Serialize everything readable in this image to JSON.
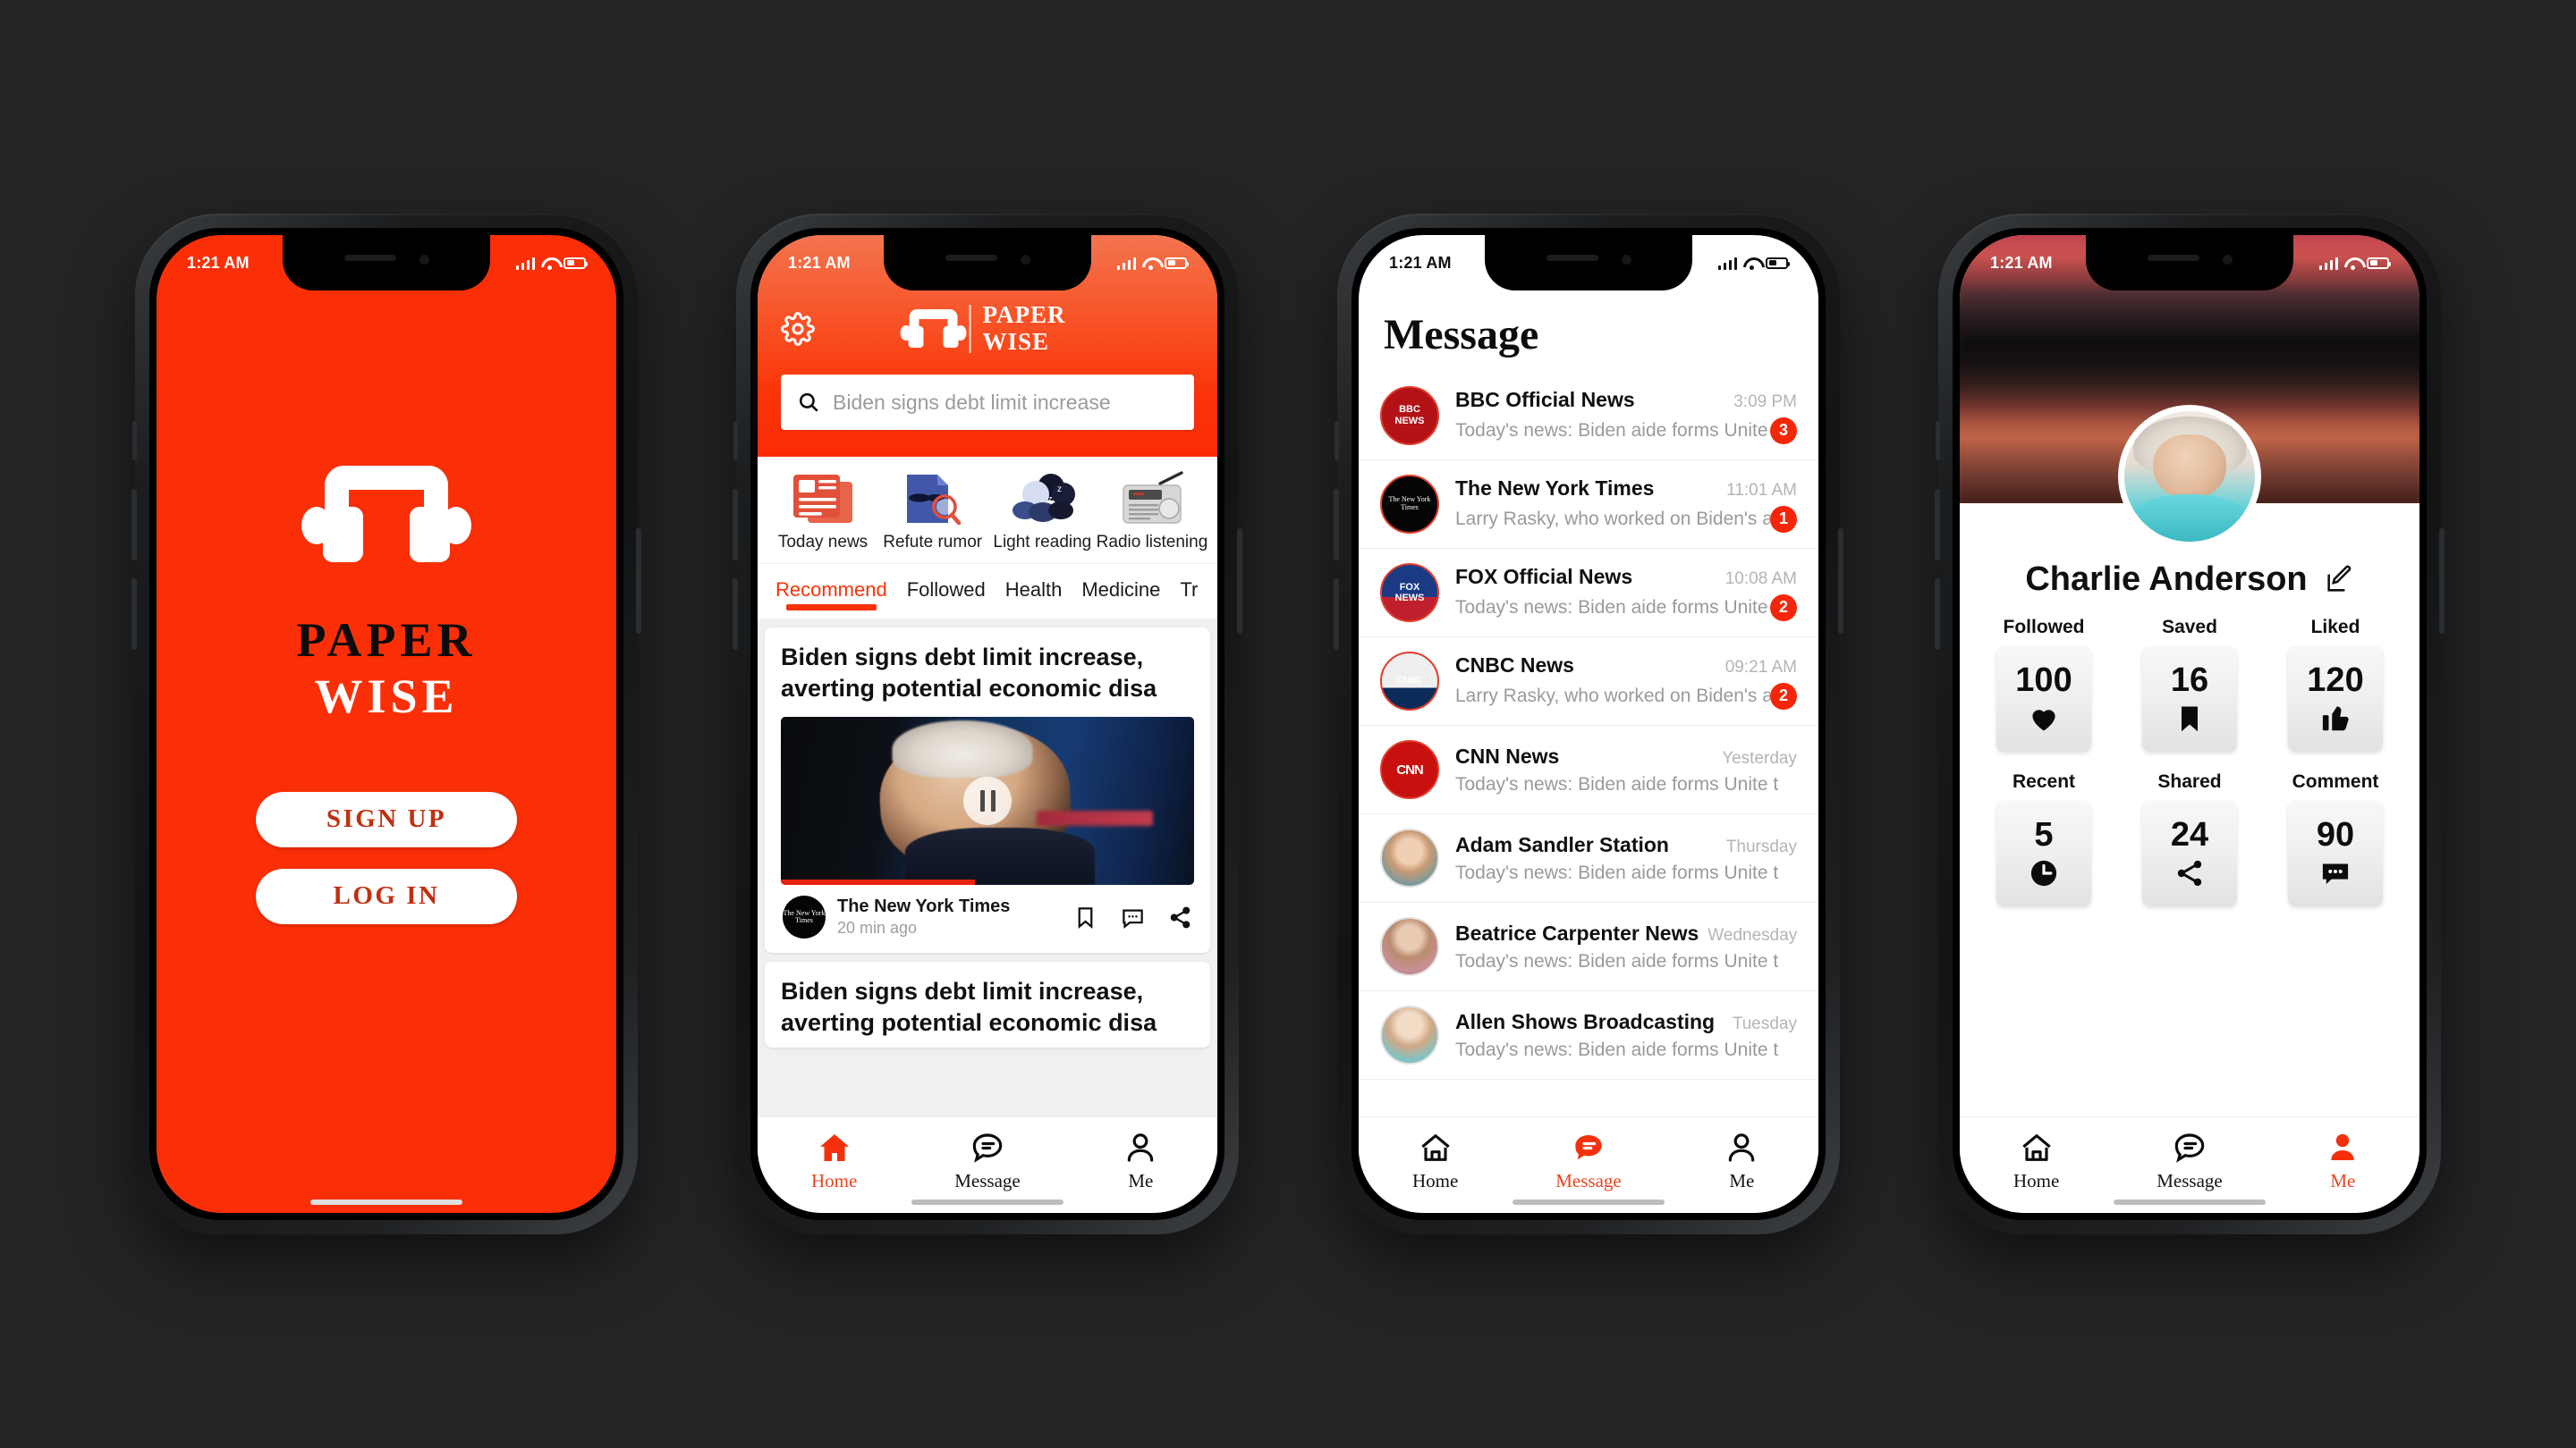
{
  "theme": {
    "brand_red": "#FA2F07",
    "accent_red": "#F93207",
    "page_bg": "#242424"
  },
  "status_bar": {
    "time": "1:21 AM",
    "signal_icon": "signal-bars-icon",
    "wifi_icon": "wifi-icon",
    "battery_icon": "battery-icon"
  },
  "screen_splash": {
    "logo_icon": "headphones-logo-icon",
    "brand_line1": "PAPER",
    "brand_line2": "WISE",
    "signup_label": "SIGN UP",
    "login_label": "LOG IN"
  },
  "screen_home": {
    "settings_icon": "gear-icon",
    "brand_line1": "PAPER",
    "brand_line2": "WISE",
    "search": {
      "icon": "search-icon",
      "value": "",
      "placeholder": "Biden signs debt limit increase"
    },
    "categories": [
      {
        "label": "Today news",
        "icon": "newspaper-icon"
      },
      {
        "label": "Refute rumor",
        "icon": "document-magnifier-icon"
      },
      {
        "label": "Light reading",
        "icon": "sleep-clouds-icon"
      },
      {
        "label": "Radio listening",
        "icon": "radio-icon"
      }
    ],
    "tabs": [
      {
        "label": "Recommend",
        "active": true
      },
      {
        "label": "Followed",
        "active": false
      },
      {
        "label": "Health",
        "active": false
      },
      {
        "label": "Medicine",
        "active": false
      },
      {
        "label": "Tr",
        "active": false
      }
    ],
    "tabs_more_icon": "chevron-down-icon",
    "articles": [
      {
        "title": "Biden signs debt limit increase, averting potential economic disa",
        "has_media": true,
        "media_type": "video",
        "play_icon": "pause-icon",
        "source": "The New York Times",
        "source_avatar": "nyt-logo-icon",
        "time": "20 min ago",
        "actions": [
          "bookmark-icon",
          "comment-icon",
          "share-icon"
        ]
      },
      {
        "title": "Biden signs debt limit increase, averting potential economic disa",
        "has_media": false
      }
    ]
  },
  "screen_message": {
    "title": "Message",
    "rows": [
      {
        "name": "BBC Official News",
        "time": "3:09 PM",
        "preview": "Today's news: Biden aide forms Unite t",
        "badge": "3",
        "avatar": "bbc-news-logo"
      },
      {
        "name": "The New York Times",
        "time": "11:01 AM",
        "preview": "Larry Rasky, who worked on Biden's aid",
        "badge": "1",
        "avatar": "nyt-logo"
      },
      {
        "name": "FOX Official News",
        "time": "10:08 AM",
        "preview": "Today's news: Biden aide forms Unite t",
        "badge": "2",
        "avatar": "fox-news-logo"
      },
      {
        "name": "CNBC News",
        "time": "09:21 AM",
        "preview": "Larry Rasky, who worked on Biden's aid",
        "badge": "2",
        "avatar": "cnbc-logo"
      },
      {
        "name": "CNN News",
        "time": "Yesterday",
        "preview": "Today's news: Biden aide forms Unite t",
        "badge": "",
        "avatar": "cnn-logo"
      },
      {
        "name": "Adam Sandler Station",
        "time": "Thursday",
        "preview": "Today's news: Biden aide forms Unite t",
        "badge": "",
        "avatar": "user-photo"
      },
      {
        "name": "Beatrice Carpenter News",
        "time": "Wednesday",
        "preview": "Today's news: Biden aide forms Unite t",
        "badge": "",
        "avatar": "user-photo"
      },
      {
        "name": "Allen Shows Broadcasting",
        "time": "Tuesday",
        "preview": "Today's news: Biden aide forms Unite t",
        "badge": "",
        "avatar": "user-photo"
      }
    ]
  },
  "screen_profile": {
    "cover_image": "sunset-landscape-photo",
    "avatar": "user-portrait-photo",
    "name": "Charlie Anderson",
    "edit_icon": "edit-pencil-icon",
    "stats_row1": [
      {
        "label": "Followed",
        "value": "100",
        "icon": "heart-icon"
      },
      {
        "label": "Saved",
        "value": "16",
        "icon": "bookmark-icon"
      },
      {
        "label": "Liked",
        "value": "120",
        "icon": "thumbs-up-icon"
      }
    ],
    "stats_row2": [
      {
        "label": "Recent",
        "value": "5",
        "icon": "clock-icon"
      },
      {
        "label": "Shared",
        "value": "24",
        "icon": "share-icon"
      },
      {
        "label": "Comment",
        "value": "90",
        "icon": "comment-dots-icon"
      }
    ]
  },
  "tabbar": {
    "home": {
      "label": "Home",
      "icon": "home-icon"
    },
    "message": {
      "label": "Message",
      "icon": "chat-bubble-icon"
    },
    "me": {
      "label": "Me",
      "icon": "person-icon"
    }
  }
}
